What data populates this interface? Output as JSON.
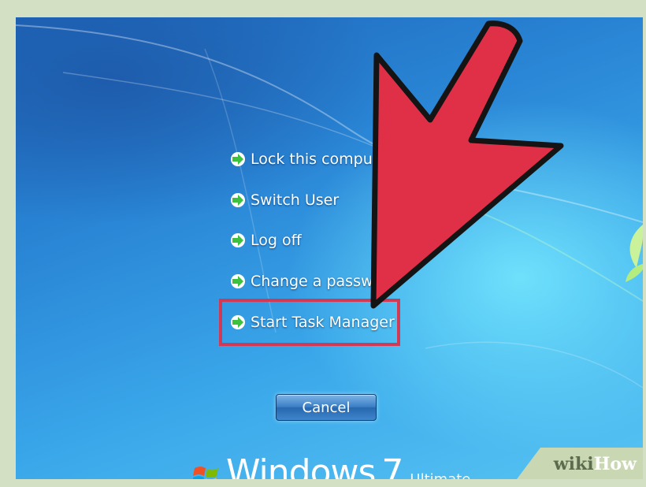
{
  "menu": {
    "items": [
      {
        "label": "Lock this compu"
      },
      {
        "label": "Switch User"
      },
      {
        "label": "Log off"
      },
      {
        "label": "Change a passw"
      },
      {
        "label": "Start Task Manager"
      }
    ],
    "icon": "green-right-arrow-icon"
  },
  "cancel": {
    "label": "Cancel"
  },
  "branding": {
    "windows_word": "Windows",
    "windows_version": "7",
    "windows_edition": "Ultimate"
  },
  "watermark": {
    "wiki": "wiki",
    "how": "How"
  },
  "colors": {
    "highlight": "#d03a55",
    "pointer_arrow": "#e03048",
    "icon_green": "#3ec13e"
  }
}
